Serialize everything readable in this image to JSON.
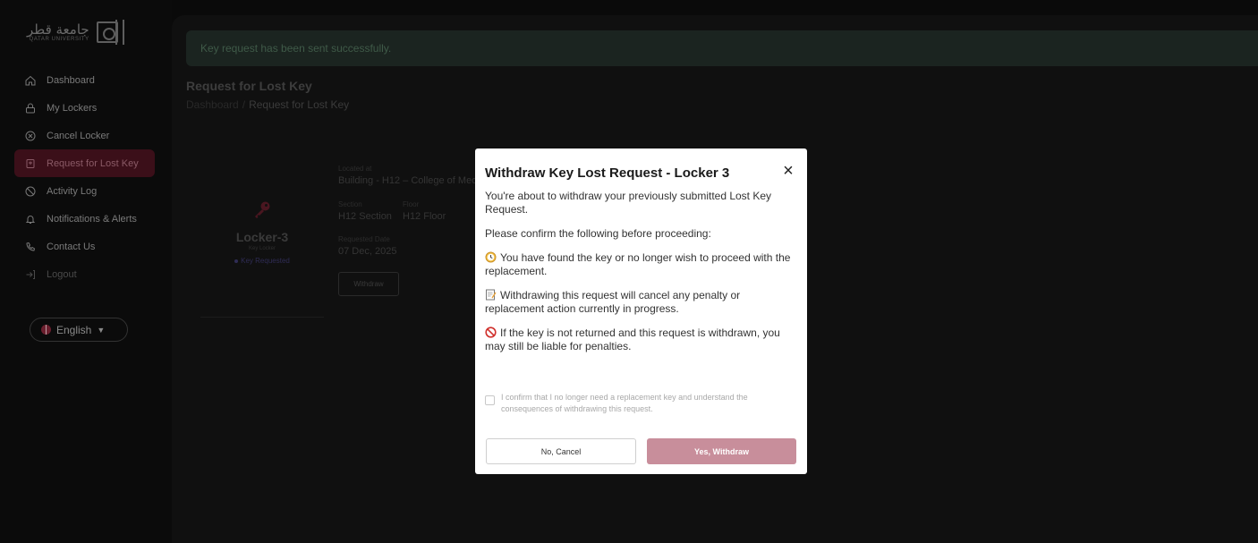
{
  "sidebar": {
    "logo": {
      "arabic": "جامعة قطر",
      "english": "QATAR UNIVERSITY"
    },
    "items": [
      {
        "label": "Dashboard",
        "icon": "home-icon"
      },
      {
        "label": "My Lockers",
        "icon": "lock-icon"
      },
      {
        "label": "Cancel Locker",
        "icon": "cancel-circle-icon"
      },
      {
        "label": "Request for Lost Key",
        "icon": "key-request-icon",
        "active": true
      },
      {
        "label": "Activity Log",
        "icon": "history-icon"
      },
      {
        "label": "Notifications & Alerts",
        "icon": "bell-icon"
      },
      {
        "label": "Contact Us",
        "icon": "phone-icon"
      },
      {
        "label": "Logout",
        "icon": "logout-icon"
      }
    ],
    "language": "English"
  },
  "alert": {
    "message": "Key request has been sent successfully."
  },
  "page": {
    "title": "Request for Lost Key",
    "breadcrumb": {
      "root": "Dashboard",
      "separator": "/",
      "current": "Request for Lost Key"
    }
  },
  "locker": {
    "name": "Locker-3",
    "type": "Key Locker",
    "status": "Key Requested",
    "located_label": "Located at",
    "located_value": "Building - H12 – College of Medic",
    "section_label": "Section",
    "section_value": "H12 Section",
    "floor_label": "Floor",
    "floor_value": "H12 Floor",
    "date_label": "Requested Date",
    "date_value": "07 Dec, 2025",
    "withdraw_label": "Withdraw"
  },
  "modal": {
    "title": "Withdraw Key Lost Request - Locker 3",
    "intro": "You're about to withdraw your previously submitted Lost Key Request.",
    "prompt": "Please confirm the following before proceeding:",
    "points": [
      "You have found the key or no longer wish to proceed with the replacement.",
      "Withdrawing this request will cancel any penalty or replacement action currently in progress.",
      "If the key is not returned and this request is withdrawn, you may still be liable for penalties."
    ],
    "confirm_text": "I confirm that I no longer need a replacement key and understand the consequences of withdrawing this request.",
    "cancel_label": "No, Cancel",
    "withdraw_label": "Yes, Withdraw"
  },
  "colors": {
    "accent": "#c88e9b",
    "active_nav": "#3b0f19",
    "overlay": "#0a0a0a"
  }
}
